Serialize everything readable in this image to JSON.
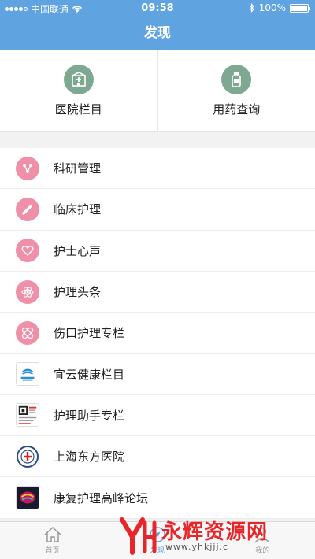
{
  "status_bar": {
    "carrier": "中国联通",
    "time": "09:58",
    "battery": "100%",
    "signal_bars": 4,
    "signal_max": 5
  },
  "nav": {
    "title": "发现"
  },
  "quick_actions": [
    {
      "label": "医院栏目",
      "icon": "hospital-icon"
    },
    {
      "label": "用药查询",
      "icon": "medicine-bottle-icon"
    }
  ],
  "list": [
    {
      "label": "科研管理",
      "icon": "molecule-icon"
    },
    {
      "label": "临床护理",
      "icon": "syringe-icon"
    },
    {
      "label": "护士心声",
      "icon": "heart-icon"
    },
    {
      "label": "护理头条",
      "icon": "atom-icon"
    },
    {
      "label": "伤口护理专栏",
      "icon": "bandage-icon"
    },
    {
      "label": "宜云健康栏目",
      "icon": "yiyun-logo"
    },
    {
      "label": "护理助手专栏",
      "icon": "qr-thumbnail"
    },
    {
      "label": "上海东方医院",
      "icon": "hospital-emblem"
    },
    {
      "label": "康复护理高峰论坛",
      "icon": "brain-thumbnail"
    }
  ],
  "tabs": [
    {
      "label": "首页",
      "icon": "home-icon",
      "active": false
    },
    {
      "label": "发现",
      "icon": "discover-icon",
      "active": true
    },
    {
      "label": "我的",
      "icon": "profile-icon",
      "active": false
    }
  ],
  "watermark": {
    "title": "永辉资源网",
    "url": "www.yhkjjj.c"
  },
  "colors": {
    "primary": "#5fa3e0",
    "accent_pink": "#ef8fa8",
    "quick_icon_bg": "#7fa892"
  }
}
